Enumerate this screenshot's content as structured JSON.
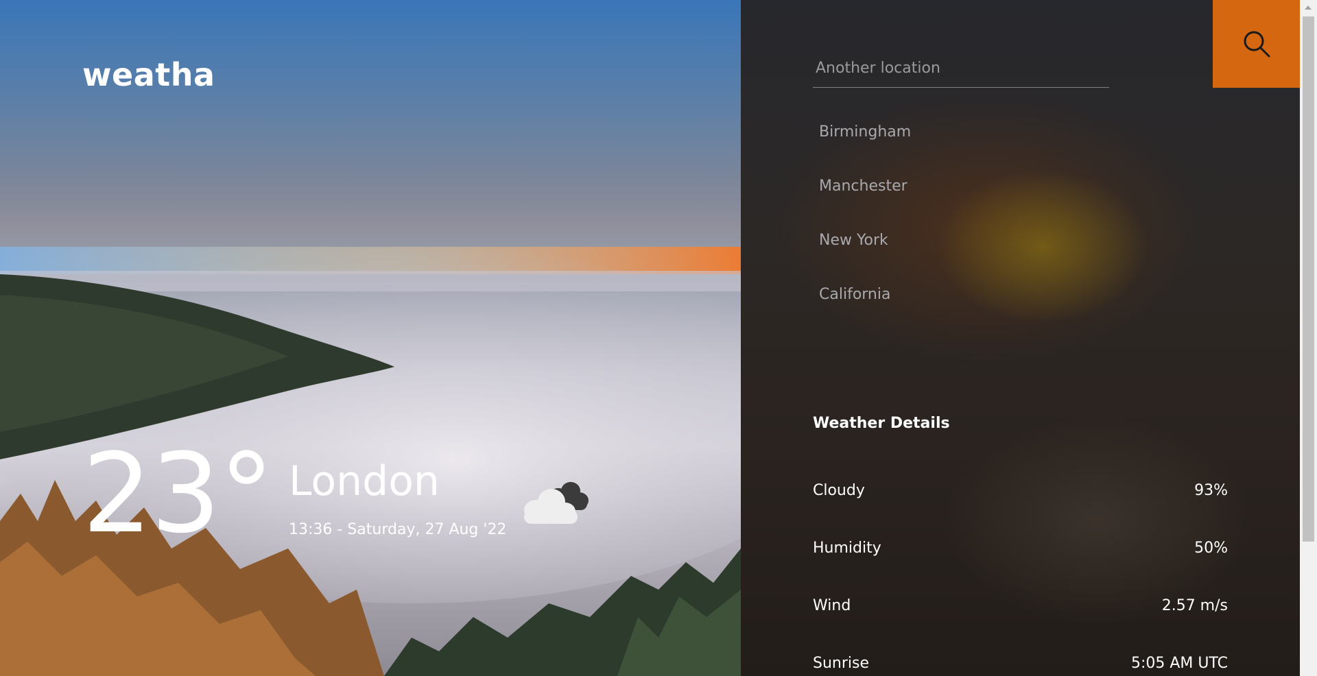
{
  "app": {
    "name": "weatha"
  },
  "current": {
    "temperature": "23°",
    "city": "London",
    "datetime": "13:36 - Saturday, 27 Aug '22",
    "condition_icon": "cloudy-icon"
  },
  "search": {
    "placeholder": "Another location",
    "value": "",
    "button_icon": "search-icon"
  },
  "locations": [
    "Birmingham",
    "Manchester",
    "New York",
    "California"
  ],
  "details": {
    "title": "Weather Details",
    "rows": [
      {
        "label": "Cloudy",
        "value": "93%"
      },
      {
        "label": "Humidity",
        "value": "50%"
      },
      {
        "label": "Wind",
        "value": "2.57 m/s"
      },
      {
        "label": "Sunrise",
        "value": "5:05 AM UTC"
      }
    ]
  },
  "colors": {
    "accent": "#d4670f",
    "panel": "#2a2624",
    "text": "#ffffff",
    "muted": "#a9a9ae"
  }
}
